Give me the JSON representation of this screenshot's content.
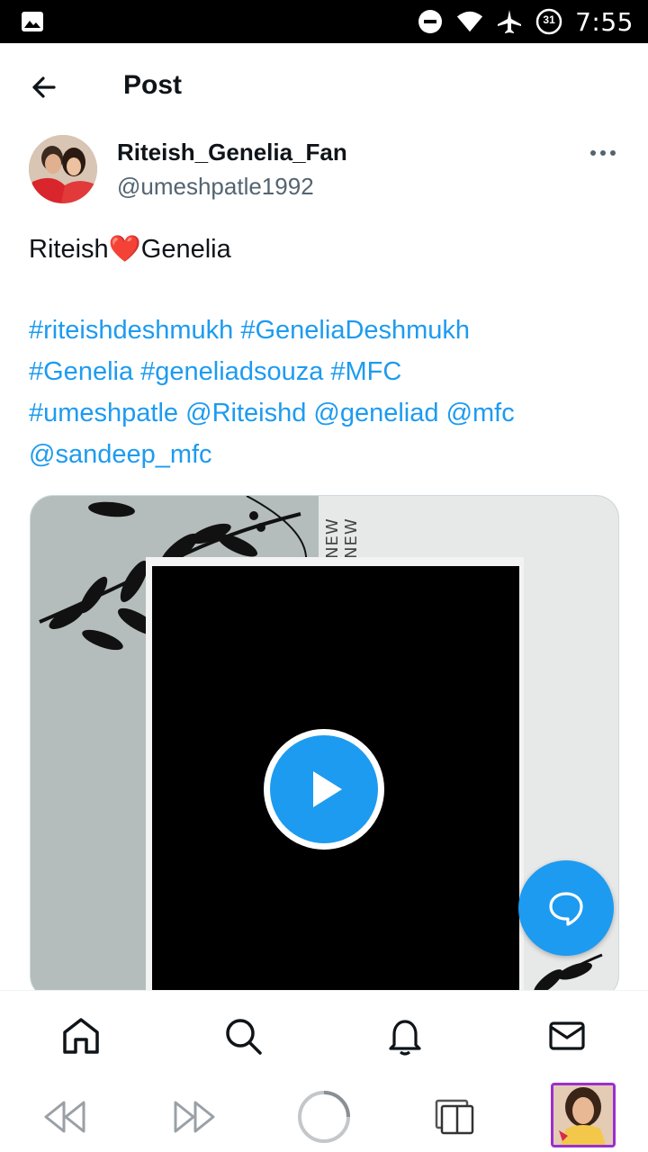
{
  "status_bar": {
    "time": "7:55",
    "battery_level": "31",
    "icons": [
      "image-icon",
      "do-not-disturb-icon",
      "wifi-icon",
      "airplane-icon",
      "battery-icon"
    ]
  },
  "header": {
    "title": "Post",
    "back_icon": "back-arrow-icon"
  },
  "author": {
    "display_name": "Riteish_Genelia_Fan",
    "handle": "@umeshpatle1992",
    "more_icon": "more-options-icon"
  },
  "post": {
    "text_before": "Riteish",
    "heart": "❤️",
    "text_after": "Genelia",
    "tags": [
      "#riteishdeshmukh",
      "#GeneliaDeshmukh",
      "#Genelia",
      "#geneliadsouza",
      "#MFC",
      "#umeshpatle",
      "@Riteishd",
      "@geneliad",
      "@mfc",
      "@sandeep_mfc"
    ]
  },
  "media": {
    "overlay_text": "NEW NEW",
    "play_icon": "play-icon"
  },
  "fab": {
    "icon": "compose-reply-icon"
  },
  "bottom_nav": {
    "items": [
      "home-icon",
      "search-icon",
      "notifications-icon",
      "messages-icon"
    ]
  },
  "browser_toolbar": {
    "items": [
      "rewind-icon",
      "fast-forward-icon",
      "loading-icon",
      "tabs-icon",
      "tab-thumbnail"
    ]
  },
  "colors": {
    "accent": "#1d9bf0",
    "text_primary": "#0f1419",
    "text_secondary": "#536471",
    "thumbnail_border": "#9b2fd0"
  }
}
